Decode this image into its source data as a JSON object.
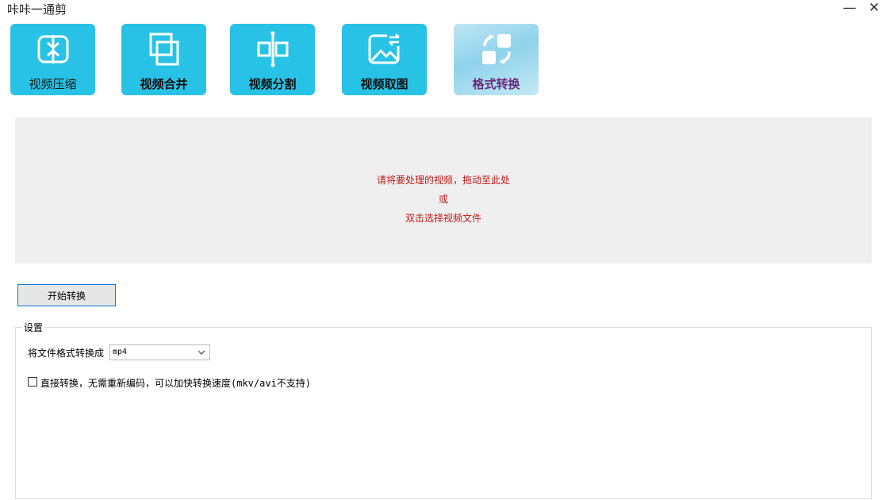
{
  "window": {
    "title": "咔咔一通剪",
    "minimize_glyph": "—",
    "close_glyph": "✕"
  },
  "toolbar": [
    {
      "label": "视频压缩",
      "icon": "compress-icon"
    },
    {
      "label": "视频合并",
      "icon": "merge-icon"
    },
    {
      "label": "视频分割",
      "icon": "split-icon"
    },
    {
      "label": "视频取图",
      "icon": "image-capture-icon"
    },
    {
      "label": "格式转换",
      "icon": "format-convert-icon",
      "active": true
    }
  ],
  "drop_zone": {
    "line1": "请将要处理的视频，拖动至此处",
    "line2": "或",
    "line3": "双击选择视频文件"
  },
  "actions": {
    "start_label": "开始转换"
  },
  "settings": {
    "group_title": "设置",
    "format_label": "将文件格式转换成",
    "format_value": "mp4",
    "direct_convert_label": "直接转换，无需重新编码，可以加快转换速度(mkv/avi不支持)",
    "direct_convert_checked": false
  },
  "colors": {
    "tool_bg": "#28c2e6",
    "drop_text": "#c01818",
    "focus_border": "#0a76d6"
  }
}
